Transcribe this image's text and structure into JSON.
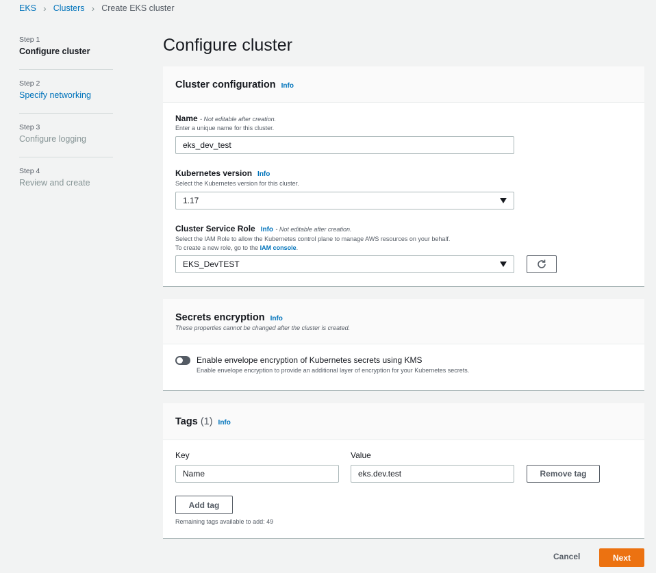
{
  "breadcrumb": {
    "items": [
      "EKS",
      "Clusters",
      "Create EKS cluster"
    ]
  },
  "steps": [
    {
      "num": "Step 1",
      "label": "Configure cluster",
      "state": "active"
    },
    {
      "num": "Step 2",
      "label": "Specify networking",
      "state": "link"
    },
    {
      "num": "Step 3",
      "label": "Configure logging",
      "state": "disabled"
    },
    {
      "num": "Step 4",
      "label": "Review and create",
      "state": "disabled"
    }
  ],
  "page_title": "Configure cluster",
  "cluster_config": {
    "title": "Cluster configuration",
    "info": "Info",
    "name_label": "Name",
    "name_note": "- Not editable after creation.",
    "name_desc": "Enter a unique name for this cluster.",
    "name_value": "eks_dev_test",
    "version_label": "Kubernetes version",
    "version_info": "Info",
    "version_desc": "Select the Kubernetes version for this cluster.",
    "version_value": "1.17",
    "role_label": "Cluster Service Role",
    "role_info": "Info",
    "role_note": "- Not editable after creation.",
    "role_desc1": "Select the IAM Role to allow the Kubernetes control plane to manage AWS resources on your behalf.",
    "role_desc2_prefix": "To create a new role, go to the ",
    "role_desc2_link": "IAM console",
    "role_desc2_suffix": ".",
    "role_value": "EKS_DevTEST"
  },
  "secrets": {
    "title": "Secrets encryption",
    "info": "Info",
    "subtitle": "These properties cannot be changed after the cluster is created.",
    "toggle_label": "Enable envelope encryption of Kubernetes secrets using KMS",
    "toggle_desc": "Enable envelope encryption to provide an additional layer of encryption for your Kubernetes secrets."
  },
  "tags": {
    "title": "Tags",
    "count": "(1)",
    "info": "Info",
    "key_header": "Key",
    "value_header": "Value",
    "key_value": "Name",
    "value_value": "eks.dev.test",
    "remove_label": "Remove tag",
    "add_label": "Add tag",
    "remaining": "Remaining tags available to add: 49"
  },
  "footer": {
    "cancel_label": "Cancel",
    "next_label": "Next"
  },
  "colors": {
    "accent": "#0073bb",
    "primary_button": "#ec7211"
  }
}
